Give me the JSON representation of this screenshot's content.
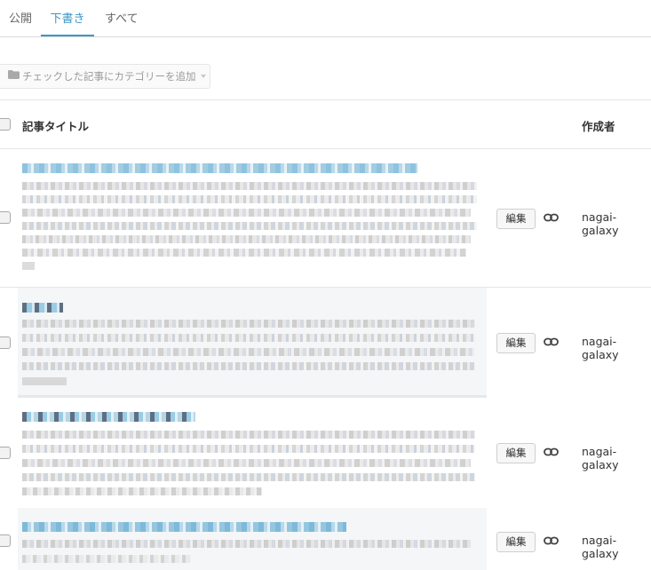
{
  "tabs": [
    {
      "label": "公開",
      "active": false
    },
    {
      "label": "下書き",
      "active": true
    },
    {
      "label": "すべて",
      "active": false
    }
  ],
  "toolbar": {
    "category_button_label": "チェックした記事にカテゴリーを追加",
    "category_button_icon": "folder-icon"
  },
  "table": {
    "columns": {
      "title": "記事タイトル",
      "author": "作成者"
    },
    "rows": [
      {
        "edit_label": "編集",
        "link_icon": "link-icon",
        "author": "nagai-galaxy",
        "highlighted": false
      },
      {
        "edit_label": "編集",
        "link_icon": "link-icon",
        "author": "nagai-galaxy",
        "highlighted": true
      },
      {
        "edit_label": "編集",
        "link_icon": "link-icon",
        "author": "nagai-galaxy",
        "highlighted": false
      },
      {
        "edit_label": "編集",
        "link_icon": "link-icon",
        "author": "nagai-galaxy",
        "highlighted": true
      }
    ]
  },
  "colors": {
    "accent": "#3d97c7",
    "row_highlight": "#f4f6f8"
  }
}
